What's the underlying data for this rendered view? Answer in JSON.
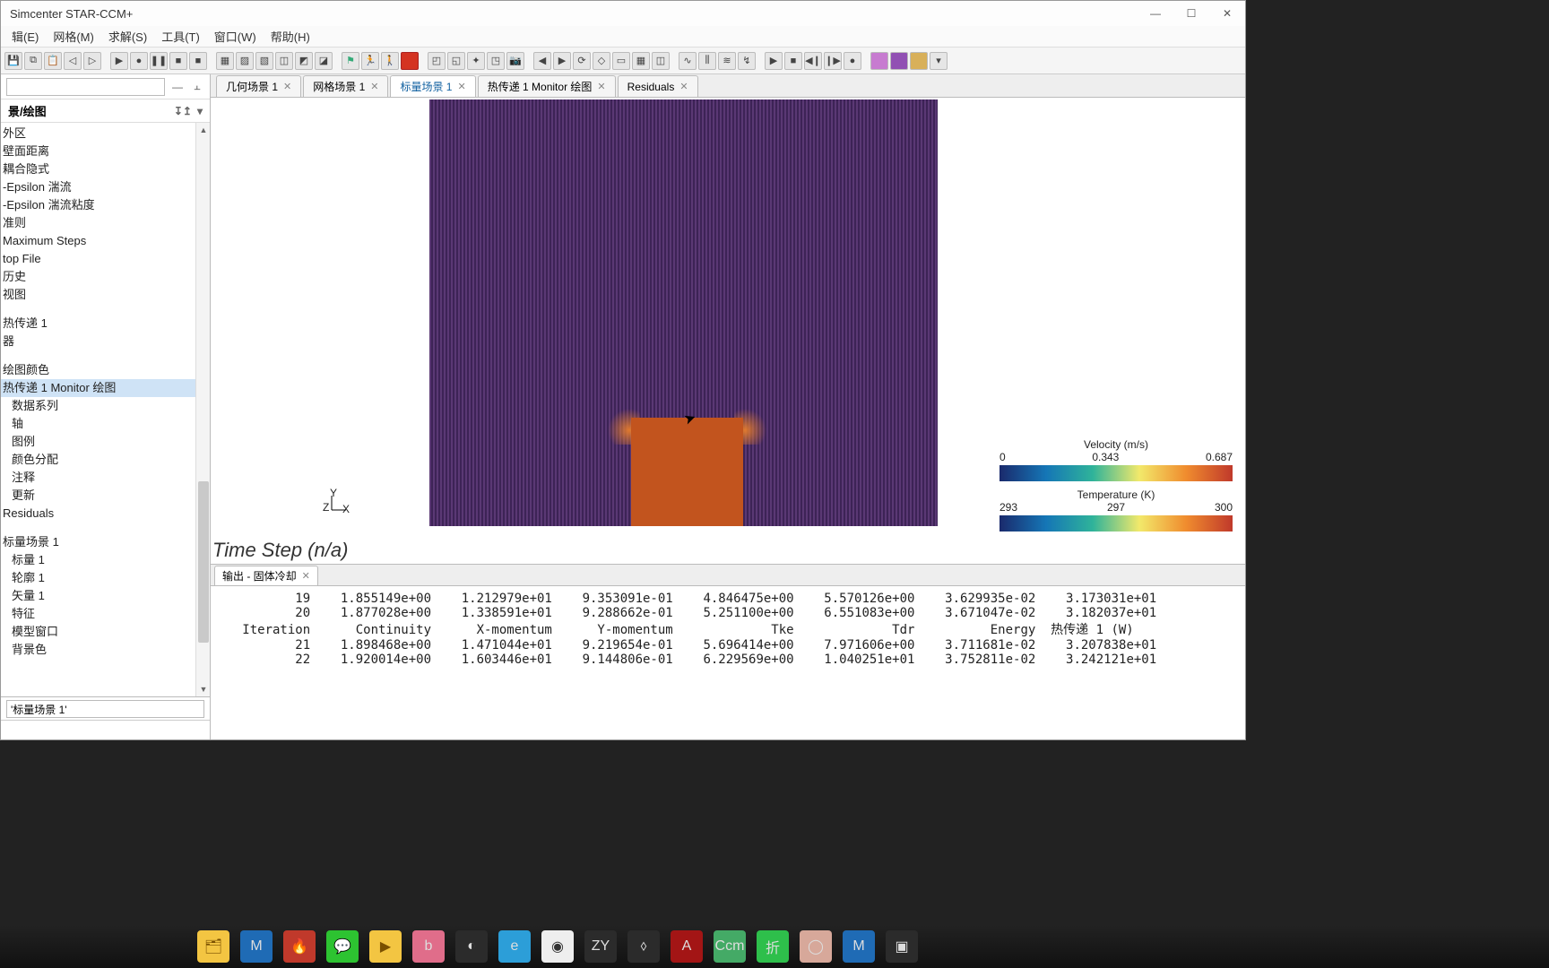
{
  "window": {
    "title": "Simcenter STAR-CCM+"
  },
  "menu": {
    "items": [
      "辑(E)",
      "网格(M)",
      "求解(S)",
      "工具(T)",
      "窗口(W)",
      "帮助(H)"
    ]
  },
  "sidebar": {
    "header": "景/绘图",
    "filter_placeholder": "",
    "nodes_a": [
      "外区",
      "壁面距离",
      "耦合隐式",
      "-Epsilon 湍流",
      "-Epsilon 湍流粘度",
      "准则",
      "Maximum Steps",
      "top File",
      "历史",
      "视图"
    ],
    "nodes_b": [
      "热传递 1",
      "器"
    ],
    "nodes_c": [
      "绘图颜色",
      "热传递 1 Monitor 绘图",
      "数据系列",
      "轴",
      "图例",
      "颜色分配",
      "注释",
      "更新",
      "Residuals"
    ],
    "nodes_d": [
      "标量场景 1",
      "标量 1",
      "轮廓 1",
      "矢量 1",
      "特征",
      "模型窗口",
      "背景色"
    ],
    "selected": "热传递 1 Monitor 绘图",
    "prop_value": "'标量场景 1'"
  },
  "tabs": [
    {
      "label": "几何场景 1",
      "active": false,
      "close": true
    },
    {
      "label": "网格场景 1",
      "active": false,
      "close": true
    },
    {
      "label": "标量场景 1",
      "active": true,
      "close": true
    },
    {
      "label": "热传递 1 Monitor 绘图",
      "active": false,
      "close": true
    },
    {
      "label": "Residuals",
      "active": false,
      "close": true
    }
  ],
  "scene": {
    "axes": {
      "x": "X",
      "y": "Y",
      "z": "Z"
    },
    "timestep": "Time Step (n/a)",
    "legends": [
      {
        "title": "Velocity (m/s)",
        "ticks": [
          "0",
          "0.343",
          "0.687"
        ]
      },
      {
        "title": "Temperature (K)",
        "ticks": [
          "293",
          "297",
          "300"
        ]
      }
    ]
  },
  "output": {
    "tab_label": "输出 - 固体冷却",
    "rows": [
      {
        "it": "19",
        "c": "1.855149e+00",
        "xm": "1.212979e+01",
        "ym": "9.353091e-01",
        "tke": "4.846475e+00",
        "tdr": "5.570126e+00",
        "en": "3.629935e-02",
        "ht": "3.173031e+01"
      },
      {
        "it": "20",
        "c": "1.877028e+00",
        "xm": "1.338591e+01",
        "ym": "9.288662e-01",
        "tke": "5.251100e+00",
        "tdr": "6.551083e+00",
        "en": "3.671047e-02",
        "ht": "3.182037e+01"
      }
    ],
    "header": {
      "it": "Iteration",
      "c": "Continuity",
      "xm": "X-momentum",
      "ym": "Y-momentum",
      "tke": "Tke",
      "tdr": "Tdr",
      "en": "Energy",
      "ht": "热传递 1 (W)"
    },
    "rows2": [
      {
        "it": "21",
        "c": "1.898468e+00",
        "xm": "1.471044e+01",
        "ym": "9.219654e-01",
        "tke": "5.696414e+00",
        "tdr": "7.971606e+00",
        "en": "3.711681e-02",
        "ht": "3.207838e+01"
      },
      {
        "it": "22",
        "c": "1.920014e+00",
        "xm": "1.603446e+01",
        "ym": "9.144806e-01",
        "tke": "6.229569e+00",
        "tdr": "1.040251e+01",
        "en": "3.752811e-02",
        "ht": "3.242121e+01"
      }
    ]
  }
}
